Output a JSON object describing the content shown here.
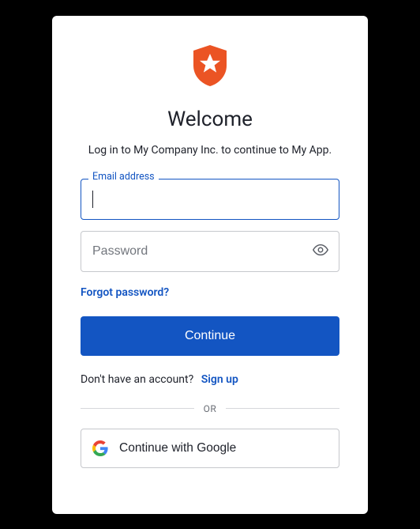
{
  "logo": {
    "name": "auth0-shield-star"
  },
  "title": "Welcome",
  "subtitle": "Log in to My Company Inc. to continue to My App.",
  "email": {
    "label": "Email address",
    "value": ""
  },
  "password": {
    "placeholder": "Password",
    "value": ""
  },
  "forgot_label": "Forgot password?",
  "continue_label": "Continue",
  "signup_prompt": "Don't have an account?",
  "signup_link": "Sign up",
  "divider_label": "OR",
  "google_label": "Continue with Google",
  "colors": {
    "primary": "#1355c2",
    "logo": "#eb5424"
  }
}
